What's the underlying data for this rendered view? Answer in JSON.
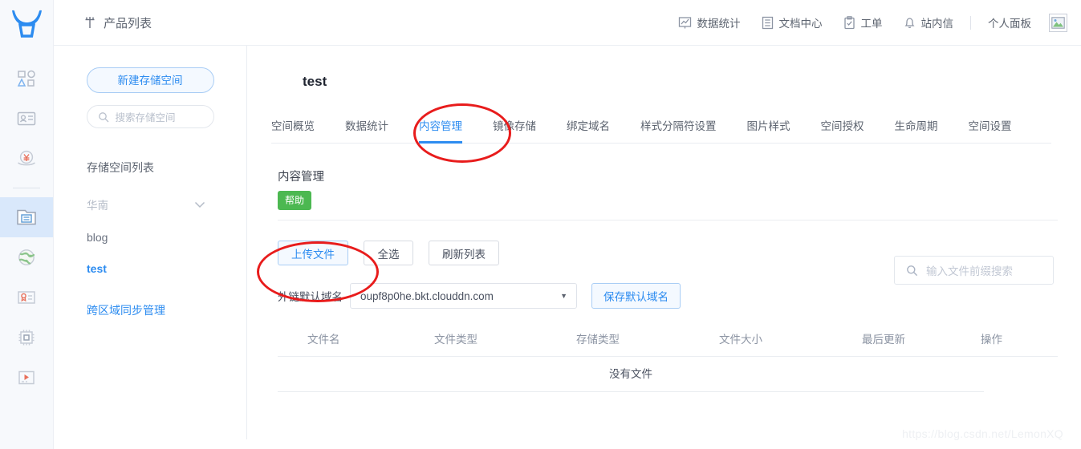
{
  "header": {
    "breadcrumb": "产品列表",
    "breadcrumb_icon": "grid-icon",
    "items": [
      {
        "label": "数据统计",
        "icon": "chart-icon"
      },
      {
        "label": "文档中心",
        "icon": "document-icon"
      },
      {
        "label": "工单",
        "icon": "clipboard-icon"
      },
      {
        "label": "站内信",
        "icon": "bell-icon"
      }
    ],
    "personal_panel": "个人面板",
    "avatar_icon": "broken-image-icon"
  },
  "rail": {
    "logo_icon": "qiniu-bull-logo",
    "items": [
      {
        "icon": "shapes-icon",
        "active": false
      },
      {
        "icon": "id-card-icon",
        "active": false
      },
      {
        "icon": "money-hand-icon",
        "active": false
      },
      {
        "icon": "folder-document-icon",
        "active": true
      },
      {
        "icon": "globe-icon",
        "active": false
      },
      {
        "icon": "certificate-icon",
        "active": false
      },
      {
        "icon": "chip-icon",
        "active": false
      },
      {
        "icon": "media-player-icon",
        "active": false
      }
    ]
  },
  "sidebar": {
    "new_bucket_label": "新建存储空间",
    "search_placeholder": "搜索存储空间",
    "search_icon": "search-icon",
    "list_title": "存储空间列表",
    "region": {
      "label": "华南",
      "chevron_icon": "chevron-down-icon"
    },
    "buckets": [
      {
        "name": "blog",
        "active": false
      },
      {
        "name": "test",
        "active": true
      }
    ],
    "cross_region_link": "跨区域同步管理"
  },
  "main": {
    "bucket_name": "test",
    "tabs": [
      {
        "label": "空间概览",
        "active": false
      },
      {
        "label": "数据统计",
        "active": false
      },
      {
        "label": "内容管理",
        "active": true
      },
      {
        "label": "镜像存储",
        "active": false
      },
      {
        "label": "绑定域名",
        "active": false
      },
      {
        "label": "样式分隔符设置",
        "active": false
      },
      {
        "label": "图片样式",
        "active": false
      },
      {
        "label": "空间授权",
        "active": false
      },
      {
        "label": "生命周期",
        "active": false
      },
      {
        "label": "空间设置",
        "active": false
      }
    ],
    "section_title": "内容管理",
    "help_badge": "帮助",
    "toolbar": {
      "upload_label": "上传文件",
      "select_all_label": "全选",
      "refresh_label": "刷新列表"
    },
    "file_search": {
      "placeholder": "输入文件前缀搜索",
      "icon": "search-icon",
      "value": ""
    },
    "domain": {
      "label": "外链默认域名",
      "selected": "oupf8p0he.bkt.clouddn.com",
      "caret_icon": "caret-down-icon",
      "save_label": "保存默认域名"
    },
    "table": {
      "columns": [
        "文件名",
        "文件类型",
        "存储类型",
        "文件大小",
        "最后更新",
        "操作"
      ],
      "rows": [],
      "empty_text": "没有文件"
    }
  },
  "annotations": {
    "accent_color": "#e81c1c",
    "circle_tab_target": "内容管理",
    "circle_button_target": "上传文件"
  },
  "watermark": "https://blog.csdn.net/LemonXQ",
  "colors": {
    "primary": "#2d8cf0",
    "help_green": "#4cb851",
    "rail_bg": "#f7f9fc",
    "rail_active": "#d9e8fb"
  }
}
